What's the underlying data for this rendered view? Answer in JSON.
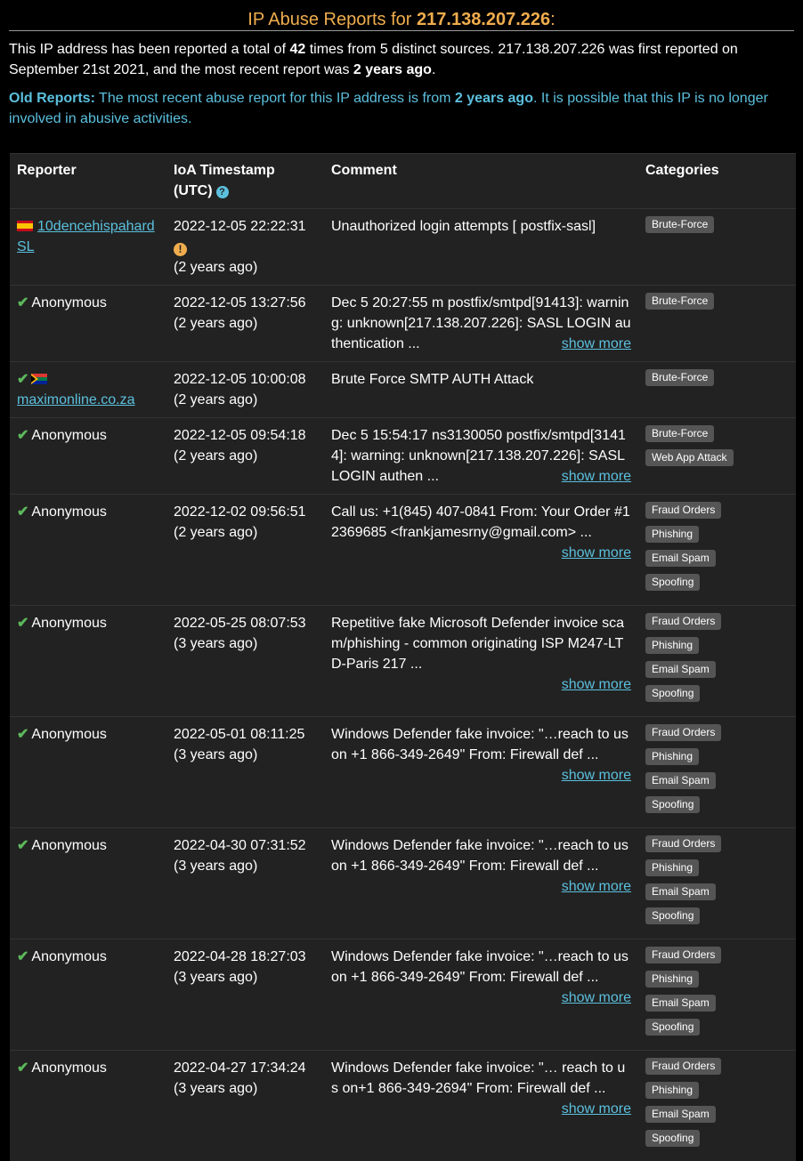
{
  "header": {
    "title_prefix": "IP Abuse Reports for ",
    "ip": "217.138.207.226",
    "title_suffix": ":"
  },
  "summary": {
    "text1": "This IP address has been reported a total of ",
    "count": "42",
    "text2": " times from 5 distinct sources. 217.138.207.226 was first reported on September 21st 2021, and the most recent report was ",
    "recent": "2 years ago",
    "text3": "."
  },
  "old_notice": {
    "label": "Old Reports:",
    "text1": " The most recent abuse report for this IP address is from ",
    "age": "2 years ago",
    "text2": ". It is possible that this IP is no longer involved in abusive activities."
  },
  "table": {
    "headers": [
      "Reporter",
      "IoA Timestamp (UTC)",
      "Comment",
      "Categories"
    ],
    "show_more": "show more",
    "rows": [
      {
        "reporter": "10dencehispahard SL",
        "flag": "es",
        "verified": false,
        "timestamp": "2022-12-05 22:22:31",
        "ago": "(2 years ago)",
        "warn": true,
        "comment": "Unauthorized login attempts [ postfix-sasl]",
        "more": false,
        "categories": [
          "Brute-Force"
        ]
      },
      {
        "reporter": "Anonymous",
        "verified": true,
        "timestamp": "2022-12-05 13:27:56",
        "ago": "(2 years ago)",
        "comment": "Dec 5 20:27:55 m postfix/smtpd[91413]: warning: unknown[217.138.207.226]: SASL LOGIN authentication ...",
        "more": true,
        "categories": [
          "Brute-Force"
        ]
      },
      {
        "reporter": "maximonline.co.za",
        "flag": "za",
        "verified": true,
        "timestamp": "2022-12-05 10:00:08",
        "ago": "(2 years ago)",
        "comment": "Brute Force SMTP AUTH Attack",
        "more": false,
        "categories": [
          "Brute-Force"
        ]
      },
      {
        "reporter": "Anonymous",
        "verified": true,
        "timestamp": "2022-12-05 09:54:18",
        "ago": "(2 years ago)",
        "comment": "Dec 5 15:54:17 ns3130050 postfix/smtpd[31414]: warning: unknown[217.138.207.226]: SASL LOGIN authen ...",
        "more": true,
        "categories": [
          "Brute-Force",
          "Web App Attack"
        ]
      },
      {
        "reporter": "Anonymous",
        "verified": true,
        "timestamp": "2022-12-02 09:56:51",
        "ago": "(2 years ago)",
        "comment": "Call us: +1(845) 407-0841 From: Your Order #12369685 <frankjamesrny@gmail.com> ...",
        "more": true,
        "categories": [
          "Fraud Orders",
          "Phishing",
          "Email Spam",
          "Spoofing"
        ]
      },
      {
        "reporter": "Anonymous",
        "verified": true,
        "timestamp": "2022-05-25 08:07:53",
        "ago": "(3 years ago)",
        "comment": "Repetitive fake Microsoft Defender invoice scam/phishing - common originating ISP M247-LTD-Paris 217 ...",
        "more": true,
        "categories": [
          "Fraud Orders",
          "Phishing",
          "Email Spam",
          "Spoofing"
        ]
      },
      {
        "reporter": "Anonymous",
        "verified": true,
        "timestamp": "2022-05-01 08:11:25",
        "ago": "(3 years ago)",
        "comment": "Windows Defender fake invoice: \"…reach to us on +1 866-349-2649\" From: Firewall def ...",
        "more": true,
        "categories": [
          "Fraud Orders",
          "Phishing",
          "Email Spam",
          "Spoofing"
        ]
      },
      {
        "reporter": "Anonymous",
        "verified": true,
        "timestamp": "2022-04-30 07:31:52",
        "ago": "(3 years ago)",
        "comment": "Windows Defender fake invoice: \"…reach to us on +1 866-349-2649\" From: Firewall def ...",
        "more": true,
        "categories": [
          "Fraud Orders",
          "Phishing",
          "Email Spam",
          "Spoofing"
        ]
      },
      {
        "reporter": "Anonymous",
        "verified": true,
        "timestamp": "2022-04-28 18:27:03",
        "ago": "(3 years ago)",
        "comment": "Windows Defender fake invoice: \"…reach to us on +1 866-349-2649\" From: Firewall def ...",
        "more": true,
        "categories": [
          "Fraud Orders",
          "Phishing",
          "Email Spam",
          "Spoofing"
        ]
      },
      {
        "reporter": "Anonymous",
        "verified": true,
        "timestamp": "2022-04-27 17:34:24",
        "ago": "(3 years ago)",
        "comment": "Windows Defender fake invoice: \"… reach to us on+1 866-349-2694\" From: Firewall def ...",
        "more": true,
        "categories": [
          "Fraud Orders",
          "Phishing",
          "Email Spam",
          "Spoofing"
        ]
      }
    ]
  },
  "colors": {
    "heading": "#f0ad4e",
    "link": "#5bc0de",
    "verified": "#5cb85c",
    "badge": "#555555",
    "table_bg": "#222222"
  }
}
